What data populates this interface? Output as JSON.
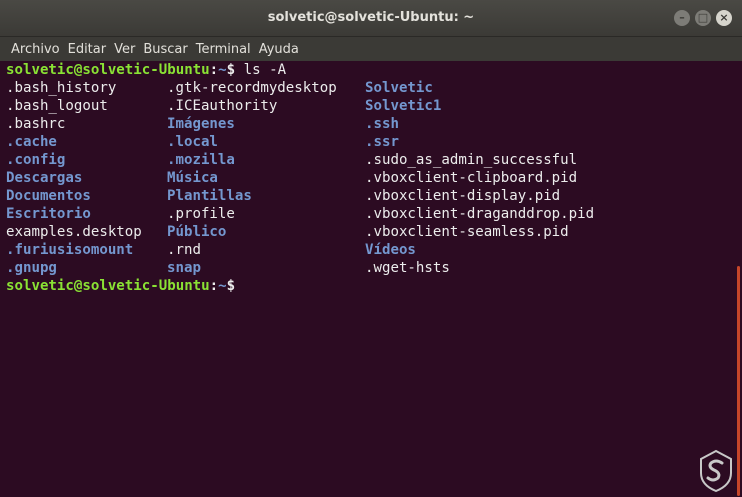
{
  "window": {
    "title": "solvetic@solvetic-Ubuntu: ~",
    "buttons": [
      "–",
      "□",
      "×"
    ]
  },
  "menu": [
    "Archivo",
    "Editar",
    "Ver",
    "Buscar",
    "Terminal",
    "Ayuda"
  ],
  "prompt": {
    "user": "solvetic@solvetic-Ubuntu",
    "sep": ":",
    "path": "~",
    "symbol": "$ ",
    "command": "ls -A"
  },
  "listing": {
    "col1": [
      {
        "name": ".bash_history",
        "type": "file"
      },
      {
        "name": ".bash_logout",
        "type": "file"
      },
      {
        "name": ".bashrc",
        "type": "file"
      },
      {
        "name": ".cache",
        "type": "dir"
      },
      {
        "name": ".config",
        "type": "dir"
      },
      {
        "name": "Descargas",
        "type": "dir"
      },
      {
        "name": "Documentos",
        "type": "dir"
      },
      {
        "name": "Escritorio",
        "type": "dir"
      },
      {
        "name": "examples.desktop",
        "type": "file"
      },
      {
        "name": ".furiusisomount",
        "type": "dir"
      },
      {
        "name": ".gnupg",
        "type": "dir"
      }
    ],
    "col2": [
      {
        "name": ".gtk-recordmydesktop",
        "type": "file"
      },
      {
        "name": ".ICEauthority",
        "type": "file"
      },
      {
        "name": "Imágenes",
        "type": "dir"
      },
      {
        "name": ".local",
        "type": "dir"
      },
      {
        "name": ".mozilla",
        "type": "dir"
      },
      {
        "name": "Música",
        "type": "dir"
      },
      {
        "name": "Plantillas",
        "type": "dir"
      },
      {
        "name": ".profile",
        "type": "file"
      },
      {
        "name": "Público",
        "type": "dir"
      },
      {
        "name": ".rnd",
        "type": "file"
      },
      {
        "name": "snap",
        "type": "dir"
      }
    ],
    "col3": [
      {
        "name": "Solvetic",
        "type": "dir"
      },
      {
        "name": "Solvetic1",
        "type": "dir"
      },
      {
        "name": ".ssh",
        "type": "dir"
      },
      {
        "name": ".ssr",
        "type": "dir"
      },
      {
        "name": ".sudo_as_admin_successful",
        "type": "file"
      },
      {
        "name": ".vboxclient-clipboard.pid",
        "type": "file"
      },
      {
        "name": ".vboxclient-display.pid",
        "type": "file"
      },
      {
        "name": ".vboxclient-draganddrop.pid",
        "type": "file"
      },
      {
        "name": ".vboxclient-seamless.pid",
        "type": "file"
      },
      {
        "name": "Vídeos",
        "type": "dir"
      },
      {
        "name": ".wget-hsts",
        "type": "file"
      }
    ]
  },
  "colors": {
    "background": "#2c0b22",
    "prompt_user": "#8ae234",
    "directory": "#7497cf",
    "file": "#ececec",
    "accent": "#c6462a"
  },
  "icons": {
    "watermark": "solvetic-logo-icon"
  }
}
